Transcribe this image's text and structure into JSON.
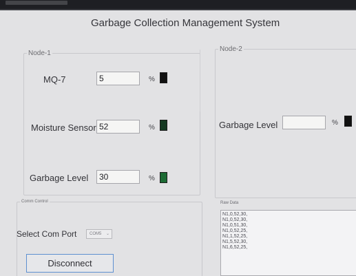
{
  "app": {
    "title": "Garbage Collection Management System"
  },
  "node1": {
    "legend": "Node-1",
    "mq7_label": "MQ-7",
    "mq7_value": "5",
    "moisture_label": "Moisture Sensor",
    "moisture_value": "52",
    "garbage_label": "Garbage Level",
    "garbage_value": "30",
    "percent": "%"
  },
  "node2": {
    "legend": "Node-2",
    "garbage_label": "Garbage Level",
    "garbage_value": "",
    "percent": "%"
  },
  "indicators": {
    "mq7_color": "#111111",
    "moisture_color": "#153a22",
    "garbage1_color": "#1d6b34",
    "garbage2_color": "#111111"
  },
  "com_control": {
    "legend": "Comm Control",
    "select_label": "Select Com Port",
    "port_value": "COM5",
    "disconnect_label": "Disconnect"
  },
  "raw_data": {
    "legend": "Raw Data",
    "lines": [
      "N1,0,52,30,",
      "N1,0,52,30,",
      "N1,0,51,30,",
      "N1,0,52,25,",
      "N1,1,52,25,",
      "N1,5,52,30,",
      "N1,6,52,25,"
    ]
  }
}
